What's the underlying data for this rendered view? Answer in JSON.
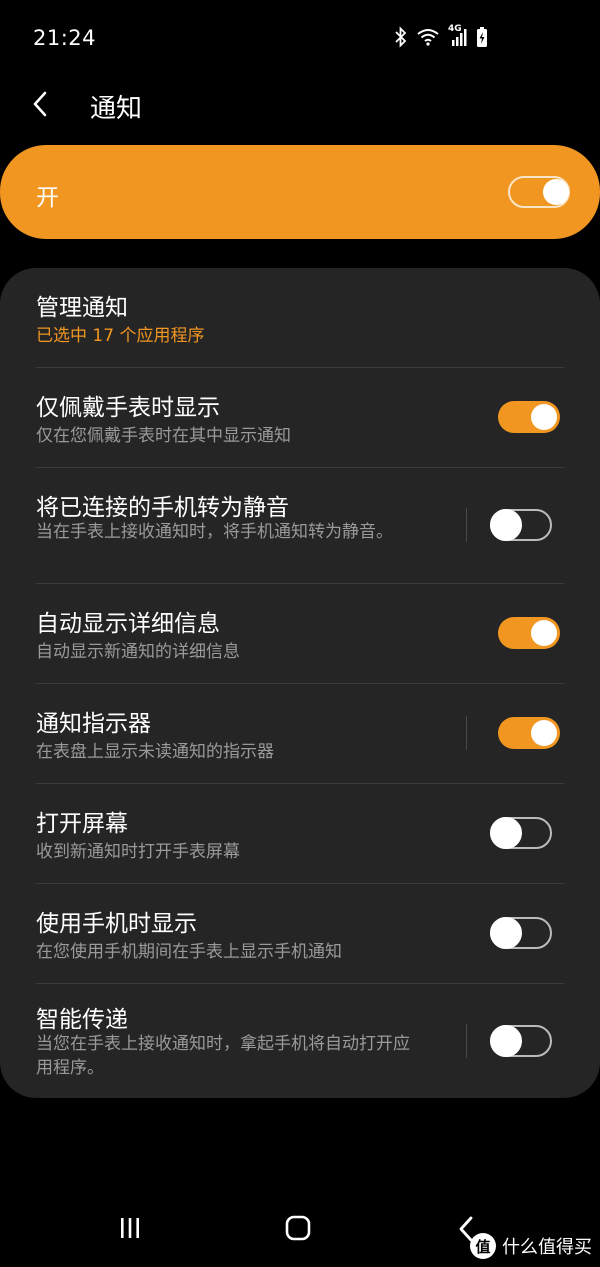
{
  "status_bar": {
    "time": "21:24",
    "network_label": "4G",
    "icons": [
      "bluetooth-icon",
      "wifi-icon",
      "cellular-signal-icon",
      "battery-charging-icon"
    ]
  },
  "header": {
    "title": "通知",
    "back_icon": "chevron-left-icon"
  },
  "master": {
    "label": "开",
    "enabled": true
  },
  "manage": {
    "title": "管理通知",
    "subtitle": "已选中 17 个应用程序"
  },
  "settings": [
    {
      "title": "仅佩戴手表时显示",
      "subtitle": "仅在您佩戴手表时在其中显示通知",
      "enabled": true
    },
    {
      "title": "将已连接的手机转为静音",
      "subtitle": "当在手表上接收通知时，将手机通知转为静音。",
      "enabled": false
    },
    {
      "title": "自动显示详细信息",
      "subtitle": "自动显示新通知的详细信息",
      "enabled": true
    },
    {
      "title": "通知指示器",
      "subtitle": "在表盘上显示未读通知的指示器",
      "enabled": true
    },
    {
      "title": "打开屏幕",
      "subtitle": "收到新通知时打开手表屏幕",
      "enabled": false
    },
    {
      "title": "使用手机时显示",
      "subtitle": "在您使用手机期间在手表上显示手机通知",
      "enabled": false
    },
    {
      "title": "智能传递",
      "subtitle": "当您在手表上接收通知时，拿起手机将自动打开应用程序。",
      "enabled": false
    }
  ],
  "navbar": {
    "icons": [
      "recents-icon",
      "home-icon",
      "back-icon"
    ]
  },
  "watermark": {
    "logo_text": "值",
    "text": "什么值得买"
  },
  "colors": {
    "accent": "#f09621",
    "background": "#000000",
    "card": "#252525",
    "secondary_text": "#9a9a9a"
  }
}
